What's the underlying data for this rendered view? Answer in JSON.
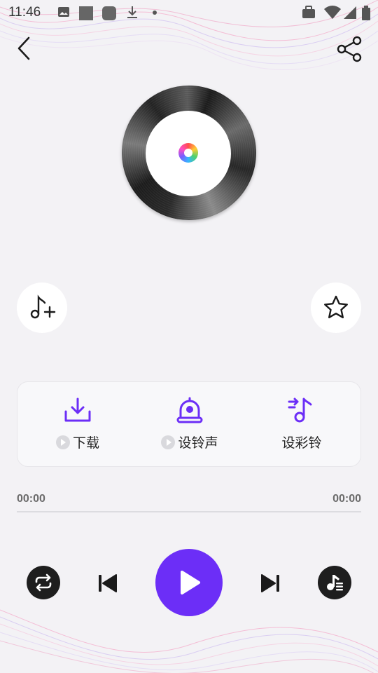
{
  "status_bar": {
    "time": "11:46",
    "icons": [
      "image-icon",
      "square-icon",
      "rounded-square-icon",
      "download-icon",
      "dot-icon",
      "briefcase-icon",
      "wifi-icon",
      "signal-icon",
      "battery-icon"
    ]
  },
  "header": {
    "back_icon": "chevron-left-icon",
    "share_icon": "share-icon"
  },
  "side_buttons": {
    "add_to_list_icon": "music-note-plus-icon",
    "favorite_icon": "star-icon"
  },
  "actions": [
    {
      "label": "下载",
      "icon": "download-tray-icon",
      "has_preview": true
    },
    {
      "label": "设铃声",
      "icon": "alarm-bell-icon",
      "has_preview": true
    },
    {
      "label": "设彩铃",
      "icon": "music-note-arrow-icon",
      "has_preview": false
    }
  ],
  "player": {
    "current_time": "00:00",
    "total_time": "00:00",
    "progress": 0,
    "controls": [
      "repeat-icon",
      "previous-icon",
      "play-icon",
      "next-icon",
      "playlist-icon"
    ]
  },
  "colors": {
    "accent": "#6c2ef7",
    "background": "#f3f2f5",
    "dark_button": "#1e1e1e"
  }
}
